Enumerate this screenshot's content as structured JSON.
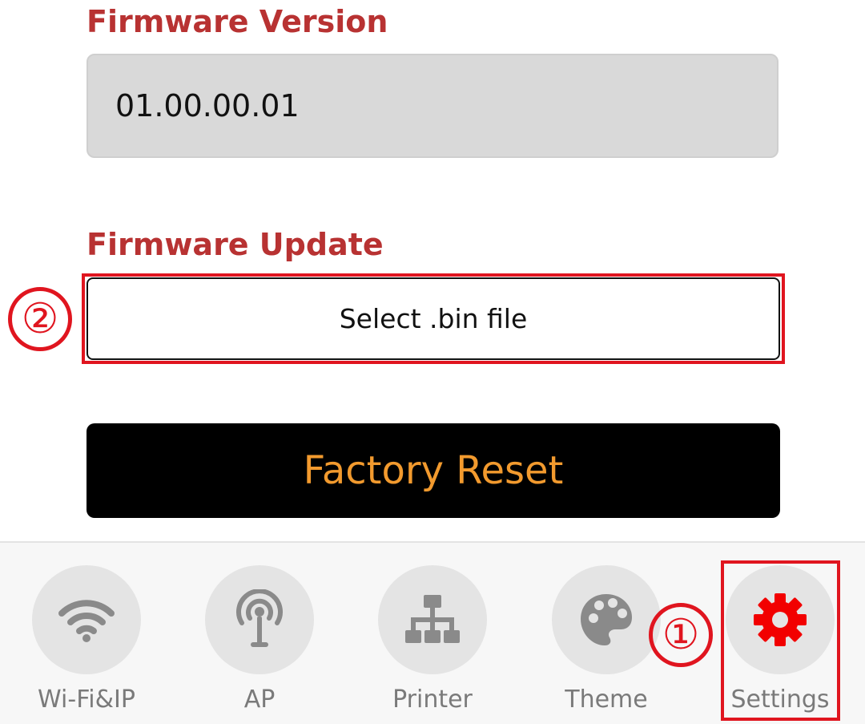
{
  "firmware": {
    "version_title": "Firmware Version",
    "version_value": "01.00.00.01",
    "update_title": "Firmware Update",
    "select_file_label": "Select .bin file",
    "factory_reset_label": "Factory Reset"
  },
  "annotations": {
    "marker_1": "①",
    "marker_2": "②"
  },
  "nav": {
    "items": [
      {
        "label": "Wi-Fi&IP",
        "icon": "wifi-icon"
      },
      {
        "label": "AP",
        "icon": "antenna-icon"
      },
      {
        "label": "Printer",
        "icon": "network-tree-icon"
      },
      {
        "label": "Theme",
        "icon": "palette-icon"
      },
      {
        "label": "Settings",
        "icon": "gear-icon",
        "active": true
      }
    ]
  },
  "colors": {
    "section_title": "#b83232",
    "reset_text": "#f29a2e",
    "annotation": "#e0151f",
    "nav_icon": "#8a8a8a",
    "nav_icon_active": "#f20000"
  }
}
